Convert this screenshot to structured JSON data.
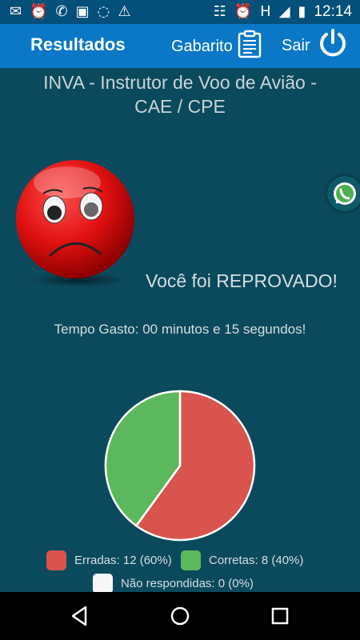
{
  "status_bar": {
    "time": "12:14",
    "h_indicator": "H",
    "left_icons": [
      "message-icon",
      "alarm-icon",
      "whatsapp-icon",
      "image-icon",
      "voicemail-icon",
      "warning-icon"
    ],
    "right_icons": [
      "vibrate-icon",
      "alarm-icon",
      "signal-icon",
      "battery-icon"
    ]
  },
  "app_bar": {
    "title": "Resultados",
    "gabarito_label": "Gabarito",
    "sair_label": "Sair"
  },
  "exam": {
    "title_line1": "INVA - Instrutor de Voo de Avião -",
    "title_line2": "CAE / CPE"
  },
  "result": {
    "message": "Você foi REPROVADO!",
    "time_spent": "Tempo Gasto: 00 minutos e 15 segundos!"
  },
  "chart_data": {
    "type": "pie",
    "slices": [
      {
        "label": "Erradas",
        "value": 12,
        "percent": 60,
        "color": "#d9534f"
      },
      {
        "label": "Corretas",
        "value": 8,
        "percent": 40,
        "color": "#5cb85c"
      },
      {
        "label": "Não respondidas",
        "value": 0,
        "percent": 0,
        "color": "#f7f7f7"
      }
    ]
  },
  "legend": {
    "erradas": "Erradas: 12 (60%)",
    "corretas": "Corretas: 8 (40%)",
    "nao_respondidas": "Não respondidas: 0 (0%)"
  },
  "colors": {
    "background": "#0b4a5c",
    "app_bar": "#0a78c7",
    "status_bar": "#03507a",
    "accent_red": "#d9534f",
    "accent_green": "#5cb85c"
  }
}
